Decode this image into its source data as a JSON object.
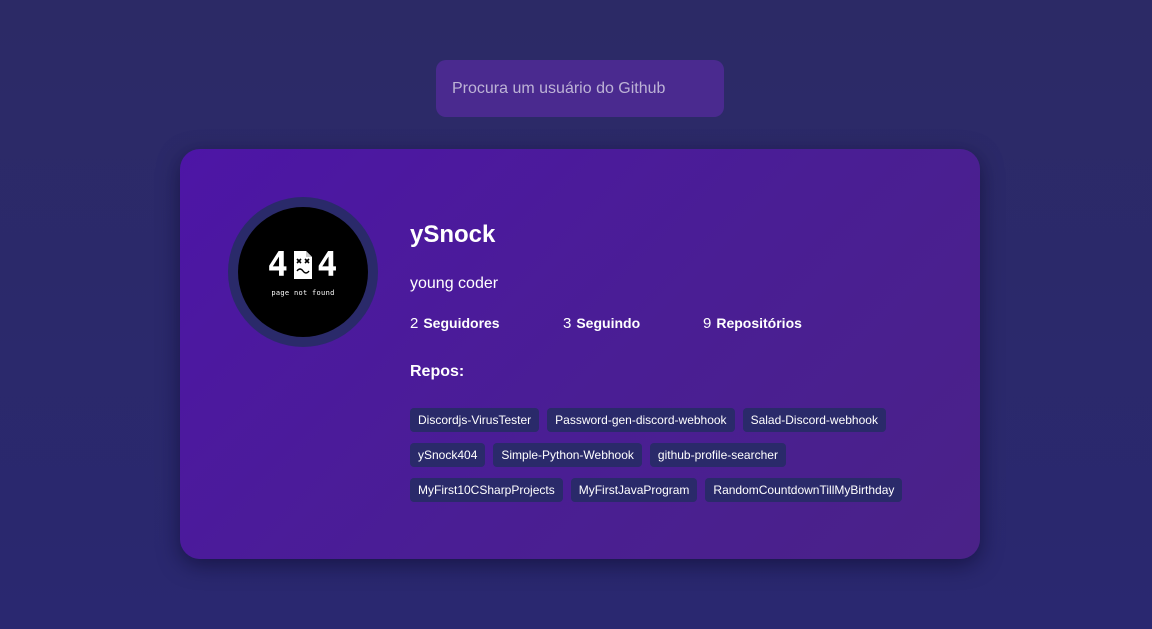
{
  "search": {
    "placeholder": "Procura um usuário do Github",
    "value": ""
  },
  "profile": {
    "avatar": {
      "main_text": "4",
      "sub_text": "page not found"
    },
    "name": "ySnock",
    "bio": "young coder",
    "stats": {
      "followers": {
        "count": "2",
        "label": "Seguidores"
      },
      "following": {
        "count": "3",
        "label": "Seguindo"
      },
      "repos": {
        "count": "9",
        "label": "Repositórios"
      }
    },
    "repos_title": "Repos:",
    "repos": [
      "Discordjs-VirusTester",
      "Password-gen-discord-webhook",
      "Salad-Discord-webhook",
      "ySnock404",
      "Simple-Python-Webhook",
      "github-profile-searcher",
      "MyFirst10CSharpProjects",
      "MyFirstJavaProgram",
      "RandomCountdownTillMyBirthday"
    ]
  },
  "colors": {
    "background": "#2b2a6a",
    "search_bg": "#4a2a8f",
    "card_bg": "#4d15a6",
    "tag_bg": "#2a2a6a",
    "text": "#ffffff"
  }
}
